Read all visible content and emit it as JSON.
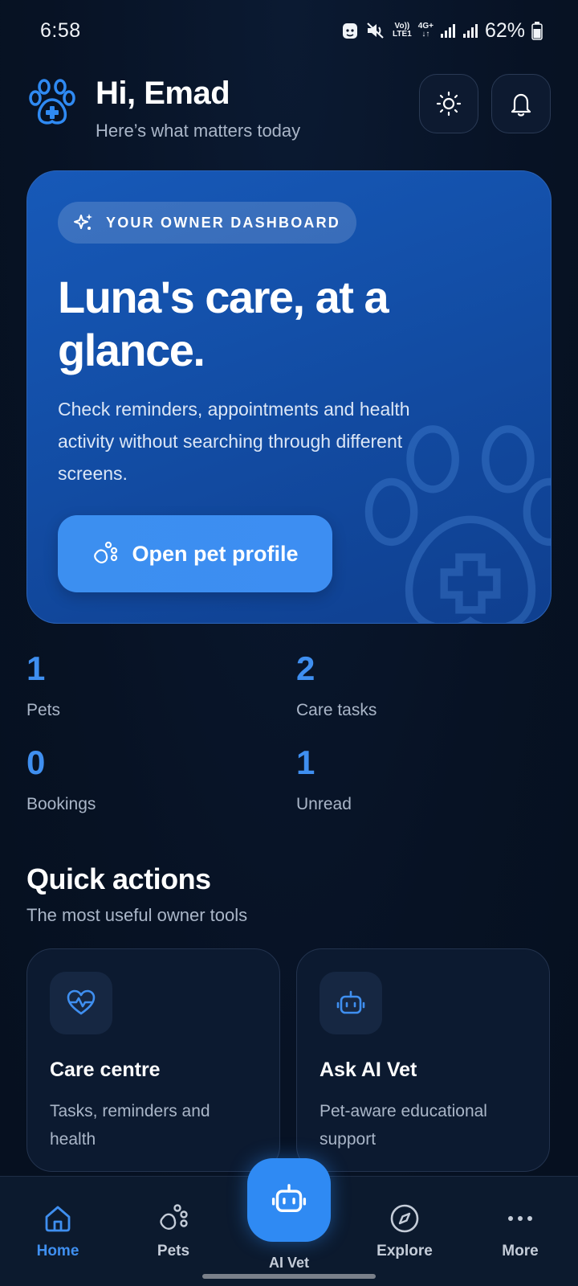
{
  "status_bar": {
    "time": "6:58",
    "network_top": "Vo))",
    "network_bottom": "LTE1",
    "network_gen": "4G+",
    "battery": "62%"
  },
  "header": {
    "greeting": "Hi, Emad",
    "subtitle": "Here’s what matters today",
    "icons": [
      "paw-medical-logo-icon",
      "sun-icon",
      "bell-icon"
    ]
  },
  "hero": {
    "pill_label": "YOUR OWNER DASHBOARD",
    "title": "Luna's care, at a glance.",
    "description": "Check reminders, appointments and health activity without searching through different screens.",
    "button_label": "Open pet profile"
  },
  "stats": [
    {
      "value": "1",
      "label": "Pets"
    },
    {
      "value": "2",
      "label": "Care tasks"
    },
    {
      "value": "0",
      "label": "Bookings"
    },
    {
      "value": "1",
      "label": "Unread"
    }
  ],
  "quick_actions": {
    "title": "Quick actions",
    "subtitle": "The most useful owner tools",
    "cards": [
      {
        "title": "Care centre",
        "description": "Tasks, reminders and health",
        "icon": "heart-pulse-icon"
      },
      {
        "title": "Ask AI Vet",
        "description": "Pet-aware educational support",
        "icon": "robot-icon"
      }
    ]
  },
  "bottom_nav": {
    "items": [
      {
        "label": "Home",
        "icon": "home-icon",
        "active": true
      },
      {
        "label": "Pets",
        "icon": "paw-icon",
        "active": false
      },
      {
        "label": "AI Vet",
        "icon": "robot-icon",
        "active": false
      },
      {
        "label": "Explore",
        "icon": "compass-icon",
        "active": false
      },
      {
        "label": "More",
        "icon": "more-dots-icon",
        "active": false
      }
    ]
  },
  "colors": {
    "background": "#081428",
    "accent": "#3f8ff0",
    "hero_card": "#1759b8",
    "muted_text": "#aab6c8"
  }
}
